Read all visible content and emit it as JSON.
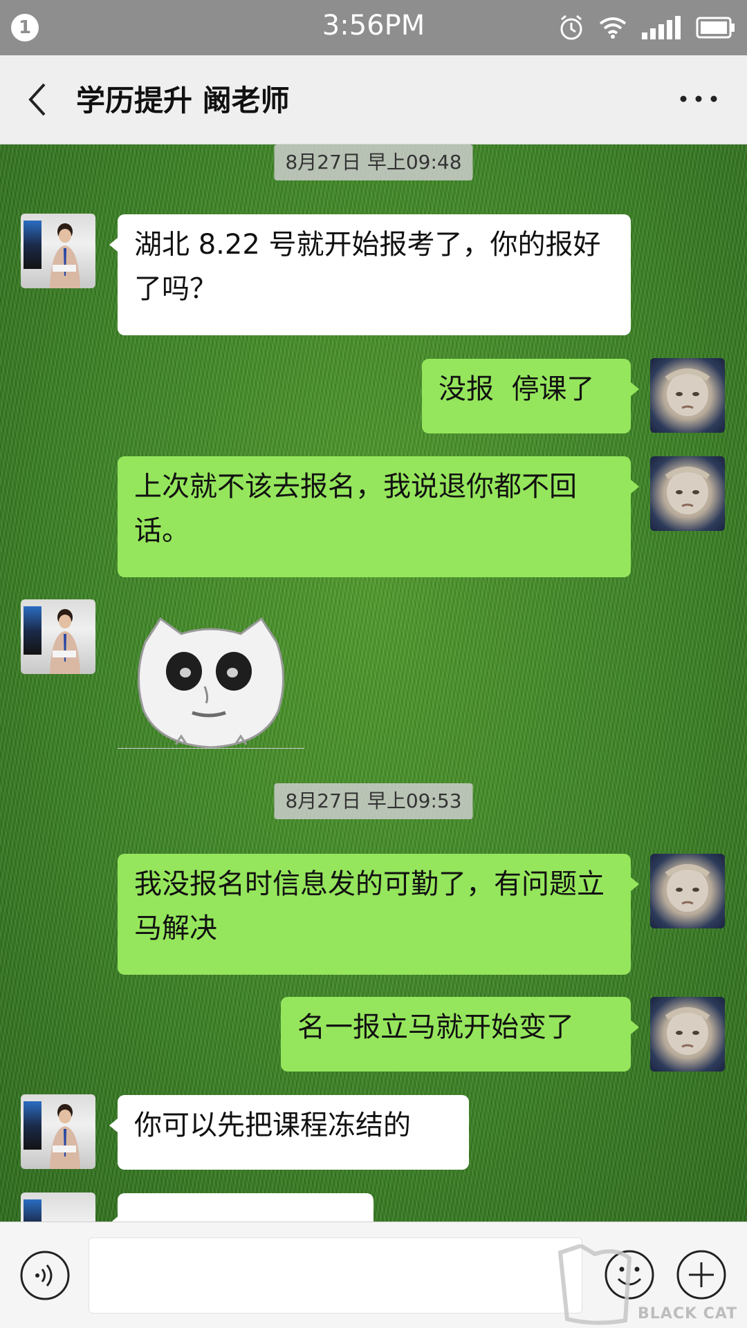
{
  "status_bar": {
    "notification_count": "1",
    "time": "3:56PM",
    "icons": [
      "alarm-icon",
      "wifi-icon",
      "signal-icon",
      "battery-icon"
    ]
  },
  "header": {
    "back_icon": "chevron-left-icon",
    "title": "学历提升 阚老师",
    "more_icon": "more-dots-icon"
  },
  "messages": [
    {
      "type": "timestamp",
      "text": "8月27日 早上09:48"
    },
    {
      "type": "text",
      "side": "left",
      "sender": "teacher",
      "text": "湖北 8.22 号就开始报考了，你的报好了吗？"
    },
    {
      "type": "text",
      "side": "right",
      "sender": "me",
      "text": "没报  停课了"
    },
    {
      "type": "text",
      "side": "right",
      "sender": "me",
      "text": "上次就不该去报名，我说退你都不回话。"
    },
    {
      "type": "sticker",
      "side": "left",
      "sender": "teacher",
      "sticker": "panda-face-sticker"
    },
    {
      "type": "timestamp",
      "text": "8月27日 早上09:53"
    },
    {
      "type": "text",
      "side": "right",
      "sender": "me",
      "text": "我没报名时信息发的可勤了，有问题立马解决"
    },
    {
      "type": "text",
      "side": "right",
      "sender": "me",
      "text": "名一报立马就开始变了"
    },
    {
      "type": "text",
      "side": "left",
      "sender": "teacher",
      "text": "你可以先把课程冻结的"
    }
  ],
  "input_bar": {
    "voice_icon": "voice-icon",
    "text_value": "",
    "emoji_icon": "emoji-icon",
    "plus_icon": "plus-icon"
  },
  "watermark": {
    "text": "BLACK CAT"
  },
  "colors": {
    "status_bar": "#8e8e8e",
    "header_bg": "#efefef",
    "bubble_right": "#95e65c",
    "bubble_left": "#ffffff",
    "timestamp_bg": "#cdcdcd"
  }
}
